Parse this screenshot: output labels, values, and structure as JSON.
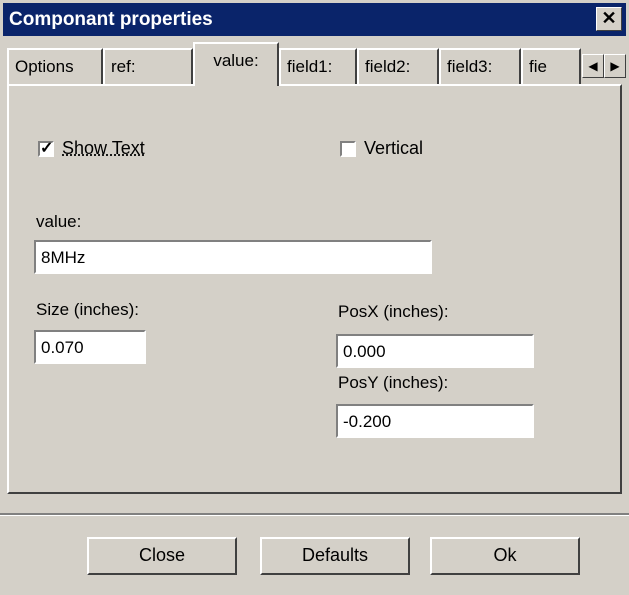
{
  "window": {
    "title": "Componant properties",
    "close_glyph": "✕"
  },
  "tabs": [
    {
      "label": "Options"
    },
    {
      "label": "ref:"
    },
    {
      "label": "value:"
    },
    {
      "label": "field1:"
    },
    {
      "label": "field2:"
    },
    {
      "label": "field3:"
    },
    {
      "label": "fie"
    }
  ],
  "tab_scroll": {
    "left_glyph": "◀",
    "right_glyph": "▶"
  },
  "form": {
    "show_text": {
      "label": "Show Text",
      "checked": true
    },
    "vertical": {
      "label": "Vertical",
      "checked": false
    },
    "value_label": "value:",
    "value": "8MHz",
    "size_label": "Size (inches):",
    "size": "0.070",
    "posx_label": "PosX (inches):",
    "posx": "0.000",
    "posy_label": "PosY (inches):",
    "posy": "-0.200"
  },
  "buttons": {
    "close": "Close",
    "defaults": "Defaults",
    "ok": "Ok"
  }
}
